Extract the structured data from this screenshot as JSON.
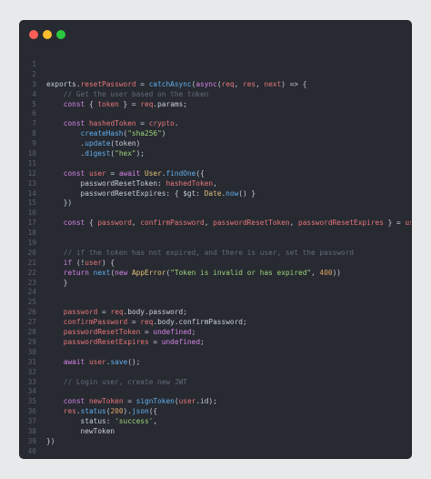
{
  "window": {
    "buttons": {
      "close": "close",
      "minimize": "minimize",
      "maximize": "maximize"
    }
  },
  "lines": [
    {
      "n": "1",
      "tokens": []
    },
    {
      "n": "2",
      "tokens": []
    },
    {
      "n": "3",
      "tokens": [
        {
          "t": "exports.",
          "c": "default"
        },
        {
          "t": "resetPassword",
          "c": "var"
        },
        {
          "t": " = ",
          "c": "default"
        },
        {
          "t": "catchAsync",
          "c": "fn"
        },
        {
          "t": "(",
          "c": "default"
        },
        {
          "t": "async",
          "c": "kw"
        },
        {
          "t": "(",
          "c": "default"
        },
        {
          "t": "req",
          "c": "var"
        },
        {
          "t": ", ",
          "c": "default"
        },
        {
          "t": "res",
          "c": "var"
        },
        {
          "t": ", ",
          "c": "default"
        },
        {
          "t": "next",
          "c": "var"
        },
        {
          "t": ") => {",
          "c": "default"
        }
      ]
    },
    {
      "n": "4",
      "tokens": [
        {
          "t": "    // Get the user based on the token",
          "c": "cm"
        }
      ]
    },
    {
      "n": "5",
      "tokens": [
        {
          "t": "    ",
          "c": "default"
        },
        {
          "t": "const",
          "c": "kw"
        },
        {
          "t": " { ",
          "c": "default"
        },
        {
          "t": "token",
          "c": "var"
        },
        {
          "t": " } = ",
          "c": "default"
        },
        {
          "t": "req",
          "c": "var"
        },
        {
          "t": ".params;",
          "c": "default"
        }
      ]
    },
    {
      "n": "6",
      "tokens": []
    },
    {
      "n": "7",
      "tokens": [
        {
          "t": "    ",
          "c": "default"
        },
        {
          "t": "const",
          "c": "kw"
        },
        {
          "t": " ",
          "c": "default"
        },
        {
          "t": "hashedToken",
          "c": "var"
        },
        {
          "t": " = ",
          "c": "default"
        },
        {
          "t": "crypto",
          "c": "var"
        },
        {
          "t": ".",
          "c": "default"
        }
      ]
    },
    {
      "n": "8",
      "tokens": [
        {
          "t": "        ",
          "c": "default"
        },
        {
          "t": "createHash",
          "c": "fn"
        },
        {
          "t": "(",
          "c": "default"
        },
        {
          "t": "\"sha256\"",
          "c": "str"
        },
        {
          "t": ")",
          "c": "default"
        }
      ]
    },
    {
      "n": "9",
      "tokens": [
        {
          "t": "        .",
          "c": "default"
        },
        {
          "t": "update",
          "c": "fn"
        },
        {
          "t": "(token)",
          "c": "default"
        }
      ]
    },
    {
      "n": "10",
      "tokens": [
        {
          "t": "        .",
          "c": "default"
        },
        {
          "t": "digest",
          "c": "fn"
        },
        {
          "t": "(",
          "c": "default"
        },
        {
          "t": "\"hex\"",
          "c": "str"
        },
        {
          "t": ");",
          "c": "default"
        }
      ]
    },
    {
      "n": "11",
      "tokens": []
    },
    {
      "n": "12",
      "tokens": [
        {
          "t": "    ",
          "c": "default"
        },
        {
          "t": "const",
          "c": "kw"
        },
        {
          "t": " ",
          "c": "default"
        },
        {
          "t": "user",
          "c": "var"
        },
        {
          "t": " = ",
          "c": "default"
        },
        {
          "t": "await",
          "c": "kw"
        },
        {
          "t": " ",
          "c": "default"
        },
        {
          "t": "User",
          "c": "cls"
        },
        {
          "t": ".",
          "c": "default"
        },
        {
          "t": "findOne",
          "c": "fn"
        },
        {
          "t": "({",
          "c": "default"
        }
      ]
    },
    {
      "n": "13",
      "tokens": [
        {
          "t": "        passwordResetToken: ",
          "c": "default"
        },
        {
          "t": "hashedToken",
          "c": "var"
        },
        {
          "t": ",",
          "c": "default"
        }
      ]
    },
    {
      "n": "14",
      "tokens": [
        {
          "t": "        passwordResetExpires: { $gt: ",
          "c": "default"
        },
        {
          "t": "Date",
          "c": "cls"
        },
        {
          "t": ".",
          "c": "default"
        },
        {
          "t": "now",
          "c": "fn"
        },
        {
          "t": "() }",
          "c": "default"
        }
      ]
    },
    {
      "n": "15",
      "tokens": [
        {
          "t": "    })",
          "c": "default"
        }
      ]
    },
    {
      "n": "16",
      "tokens": []
    },
    {
      "n": "17",
      "tokens": [
        {
          "t": "    ",
          "c": "default"
        },
        {
          "t": "const",
          "c": "kw"
        },
        {
          "t": " { ",
          "c": "default"
        },
        {
          "t": "password",
          "c": "var"
        },
        {
          "t": ", ",
          "c": "default"
        },
        {
          "t": "confirmPassword",
          "c": "var"
        },
        {
          "t": ", ",
          "c": "default"
        },
        {
          "t": "passwordResetToken",
          "c": "var"
        },
        {
          "t": ", ",
          "c": "default"
        },
        {
          "t": "passwordResetExpires",
          "c": "var"
        },
        {
          "t": " } = ",
          "c": "default"
        },
        {
          "t": "user",
          "c": "var"
        }
      ]
    },
    {
      "n": "18",
      "tokens": []
    },
    {
      "n": "19",
      "tokens": []
    },
    {
      "n": "20",
      "tokens": [
        {
          "t": "    // if the token has not expired, and there is user, set the password",
          "c": "cm"
        }
      ]
    },
    {
      "n": "21",
      "tokens": [
        {
          "t": "    ",
          "c": "default"
        },
        {
          "t": "if",
          "c": "kw"
        },
        {
          "t": " (!",
          "c": "default"
        },
        {
          "t": "user",
          "c": "var"
        },
        {
          "t": ") {",
          "c": "default"
        }
      ]
    },
    {
      "n": "22",
      "tokens": [
        {
          "t": "    ",
          "c": "default"
        },
        {
          "t": "return",
          "c": "kw"
        },
        {
          "t": " ",
          "c": "default"
        },
        {
          "t": "next",
          "c": "fn"
        },
        {
          "t": "(",
          "c": "default"
        },
        {
          "t": "new",
          "c": "kw"
        },
        {
          "t": " ",
          "c": "default"
        },
        {
          "t": "AppError",
          "c": "cls"
        },
        {
          "t": "(",
          "c": "default"
        },
        {
          "t": "\"Token is invalid or has expired\"",
          "c": "str"
        },
        {
          "t": ", ",
          "c": "default"
        },
        {
          "t": "400",
          "c": "num"
        },
        {
          "t": "))",
          "c": "default"
        }
      ]
    },
    {
      "n": "23",
      "tokens": [
        {
          "t": "    }",
          "c": "default"
        }
      ]
    },
    {
      "n": "24",
      "tokens": []
    },
    {
      "n": "25",
      "tokens": []
    },
    {
      "n": "26",
      "tokens": [
        {
          "t": "    ",
          "c": "default"
        },
        {
          "t": "password",
          "c": "var"
        },
        {
          "t": " = ",
          "c": "default"
        },
        {
          "t": "req",
          "c": "var"
        },
        {
          "t": ".body.password;",
          "c": "default"
        }
      ]
    },
    {
      "n": "27",
      "tokens": [
        {
          "t": "    ",
          "c": "default"
        },
        {
          "t": "confirmPassword",
          "c": "var"
        },
        {
          "t": " = ",
          "c": "default"
        },
        {
          "t": "req",
          "c": "var"
        },
        {
          "t": ".body.confirmPassword;",
          "c": "default"
        }
      ]
    },
    {
      "n": "28",
      "tokens": [
        {
          "t": "    ",
          "c": "default"
        },
        {
          "t": "passwordResetToken",
          "c": "var"
        },
        {
          "t": " = ",
          "c": "default"
        },
        {
          "t": "undefined",
          "c": "kw"
        },
        {
          "t": ";",
          "c": "default"
        }
      ]
    },
    {
      "n": "29",
      "tokens": [
        {
          "t": "    ",
          "c": "default"
        },
        {
          "t": "passwordResetExpires",
          "c": "var"
        },
        {
          "t": " = ",
          "c": "default"
        },
        {
          "t": "undefined",
          "c": "kw"
        },
        {
          "t": ";",
          "c": "default"
        }
      ]
    },
    {
      "n": "30",
      "tokens": []
    },
    {
      "n": "31",
      "tokens": [
        {
          "t": "    ",
          "c": "default"
        },
        {
          "t": "await",
          "c": "kw"
        },
        {
          "t": " ",
          "c": "default"
        },
        {
          "t": "user",
          "c": "var"
        },
        {
          "t": ".",
          "c": "default"
        },
        {
          "t": "save",
          "c": "fn"
        },
        {
          "t": "();",
          "c": "default"
        }
      ]
    },
    {
      "n": "32",
      "tokens": []
    },
    {
      "n": "33",
      "tokens": [
        {
          "t": "    // Login user, create new JWT",
          "c": "cm"
        }
      ]
    },
    {
      "n": "34",
      "tokens": []
    },
    {
      "n": "35",
      "tokens": [
        {
          "t": "    ",
          "c": "default"
        },
        {
          "t": "const",
          "c": "kw"
        },
        {
          "t": " ",
          "c": "default"
        },
        {
          "t": "newToken",
          "c": "var"
        },
        {
          "t": " = ",
          "c": "default"
        },
        {
          "t": "signToken",
          "c": "fn"
        },
        {
          "t": "(",
          "c": "default"
        },
        {
          "t": "user",
          "c": "var"
        },
        {
          "t": ".id);",
          "c": "default"
        }
      ]
    },
    {
      "n": "36",
      "tokens": [
        {
          "t": "    ",
          "c": "default"
        },
        {
          "t": "res",
          "c": "var"
        },
        {
          "t": ".",
          "c": "default"
        },
        {
          "t": "status",
          "c": "fn"
        },
        {
          "t": "(",
          "c": "default"
        },
        {
          "t": "200",
          "c": "num"
        },
        {
          "t": ").",
          "c": "default"
        },
        {
          "t": "json",
          "c": "fn"
        },
        {
          "t": "({",
          "c": "default"
        }
      ]
    },
    {
      "n": "37",
      "tokens": [
        {
          "t": "        status: ",
          "c": "default"
        },
        {
          "t": "'success'",
          "c": "str"
        },
        {
          "t": ",",
          "c": "default"
        }
      ]
    },
    {
      "n": "38",
      "tokens": [
        {
          "t": "        newToken",
          "c": "default"
        }
      ]
    },
    {
      "n": "39",
      "tokens": [
        {
          "t": "})",
          "c": "default"
        }
      ]
    },
    {
      "n": "40",
      "tokens": []
    },
    {
      "n": "41",
      "tokens": [
        {
          "t": "})",
          "c": "default"
        }
      ]
    }
  ],
  "colors": {
    "background": "#272a31",
    "keyword": "#d783e8",
    "function": "#62b0ef",
    "string": "#9ed27b",
    "variable": "#e8767a",
    "class": "#e4c27a",
    "comment": "#636b7a",
    "number": "#e0a067"
  }
}
